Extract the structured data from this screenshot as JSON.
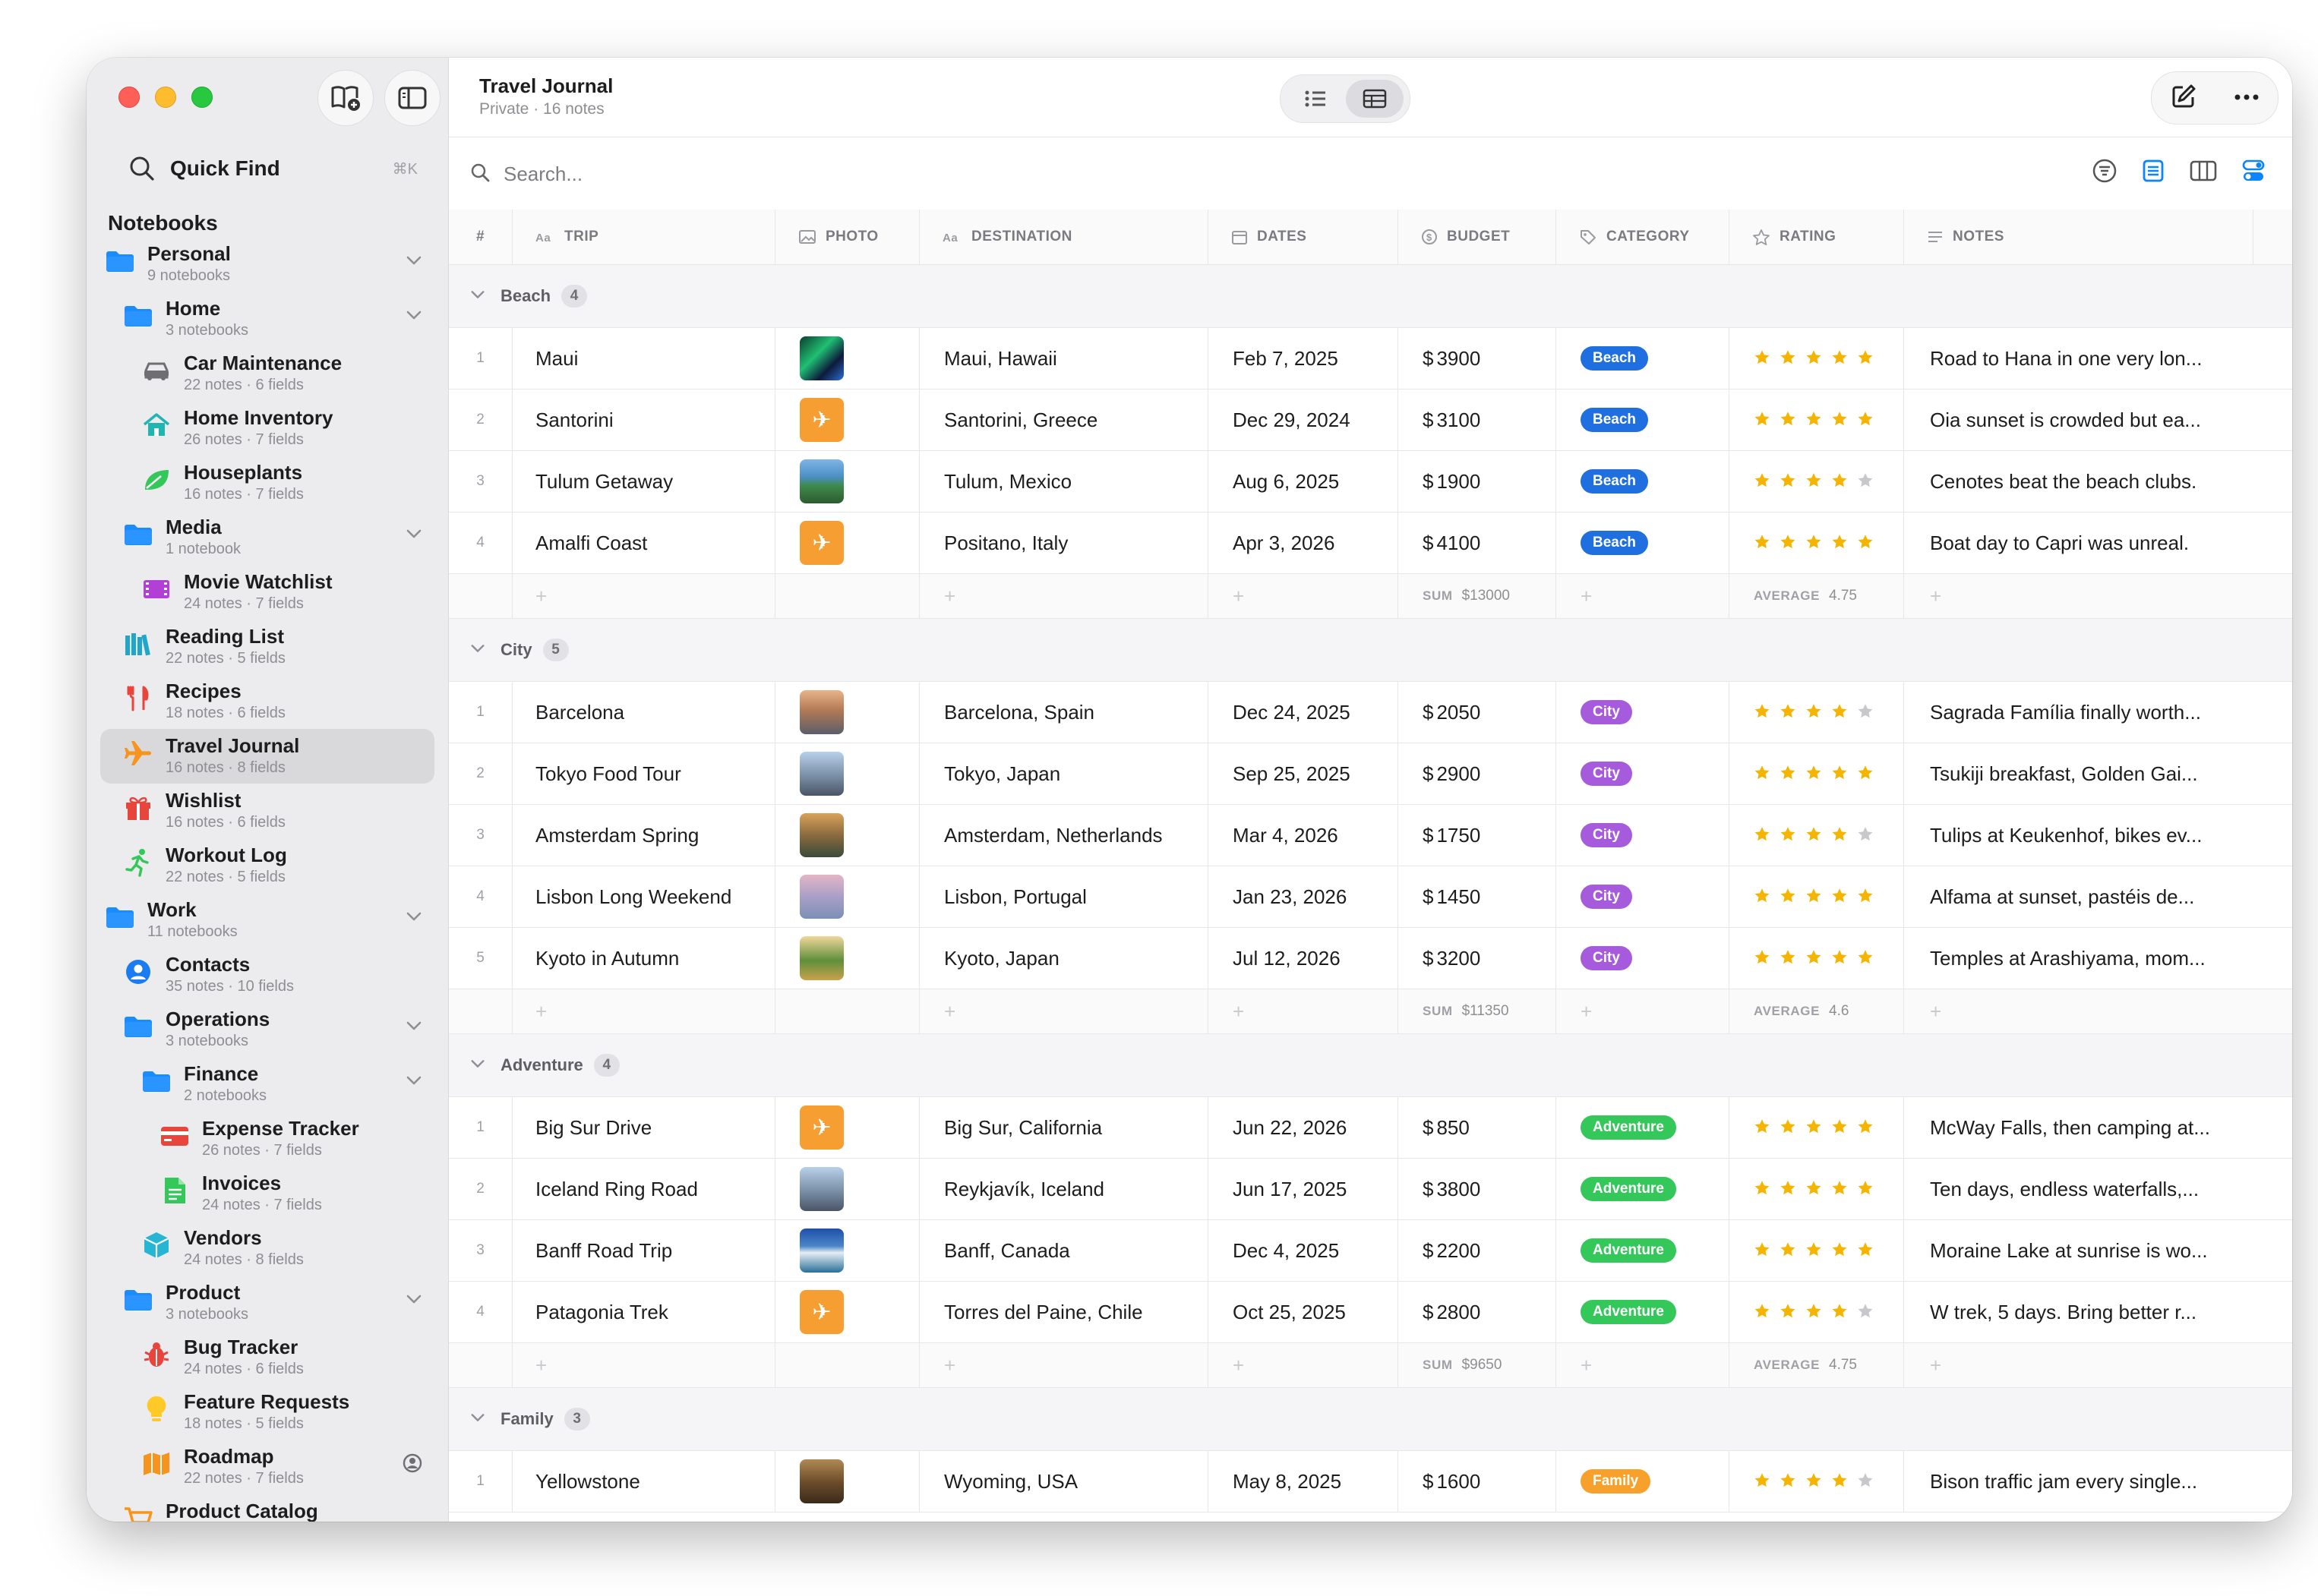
{
  "app": {
    "title": "Travel Journal",
    "subtitle": "Private · 16 notes"
  },
  "sidebar": {
    "quick_find": "Quick Find",
    "quick_find_shortcut": "⌘K",
    "notebooks_heading": "Notebooks",
    "items": [
      {
        "name": "Personal",
        "sub": "9 notebooks",
        "level": 0,
        "icon": "folder-icon",
        "chevron": true
      },
      {
        "name": "Home",
        "sub": "3 notebooks",
        "level": 1,
        "icon": "folder-icon",
        "chevron": true
      },
      {
        "name": "Car Maintenance",
        "sub": "22 notes · 6 fields",
        "level": 2,
        "icon": "car-icon"
      },
      {
        "name": "Home Inventory",
        "sub": "26 notes · 7 fields",
        "level": 2,
        "icon": "house-icon"
      },
      {
        "name": "Houseplants",
        "sub": "16 notes · 7 fields",
        "level": 2,
        "icon": "leaf-icon"
      },
      {
        "name": "Media",
        "sub": "1 notebook",
        "level": 1,
        "icon": "folder-icon",
        "chevron": true
      },
      {
        "name": "Movie Watchlist",
        "sub": "24 notes · 7 fields",
        "level": 2,
        "icon": "film-icon"
      },
      {
        "name": "Reading List",
        "sub": "22 notes · 5 fields",
        "level": 1,
        "icon": "books-icon"
      },
      {
        "name": "Recipes",
        "sub": "18 notes · 6 fields",
        "level": 1,
        "icon": "fork-knife-icon"
      },
      {
        "name": "Travel Journal",
        "sub": "16 notes · 8 fields",
        "level": 1,
        "icon": "airplane-icon",
        "selected": true
      },
      {
        "name": "Wishlist",
        "sub": "16 notes · 6 fields",
        "level": 1,
        "icon": "gift-icon"
      },
      {
        "name": "Workout Log",
        "sub": "22 notes · 5 fields",
        "level": 1,
        "icon": "running-icon"
      },
      {
        "name": "Work",
        "sub": "11 notebooks",
        "level": 0,
        "icon": "folder-icon",
        "chevron": true
      },
      {
        "name": "Contacts",
        "sub": "35 notes · 10 fields",
        "level": 1,
        "icon": "person-icon"
      },
      {
        "name": "Operations",
        "sub": "3 notebooks",
        "level": 1,
        "icon": "folder-icon",
        "chevron": true
      },
      {
        "name": "Finance",
        "sub": "2 notebooks",
        "level": 2,
        "icon": "folder-icon",
        "chevron": true
      },
      {
        "name": "Expense Tracker",
        "sub": "26 notes · 7 fields",
        "level": 3,
        "icon": "credit-card-icon"
      },
      {
        "name": "Invoices",
        "sub": "24 notes · 7 fields",
        "level": 3,
        "icon": "document-icon"
      },
      {
        "name": "Vendors",
        "sub": "24 notes · 8 fields",
        "level": 2,
        "icon": "box-icon"
      },
      {
        "name": "Product",
        "sub": "3 notebooks",
        "level": 1,
        "icon": "folder-icon",
        "chevron": true
      },
      {
        "name": "Bug Tracker",
        "sub": "24 notes · 6 fields",
        "level": 2,
        "icon": "bug-icon"
      },
      {
        "name": "Feature Requests",
        "sub": "18 notes · 5 fields",
        "level": 2,
        "icon": "lightbulb-icon"
      },
      {
        "name": "Roadmap",
        "sub": "22 notes · 7 fields",
        "level": 2,
        "icon": "map-icon",
        "shared": true
      },
      {
        "name": "Product Catalog",
        "sub": "",
        "level": 1,
        "icon": "cart-icon"
      }
    ]
  },
  "search": {
    "placeholder": "Search..."
  },
  "table": {
    "columns": [
      {
        "key": "num",
        "label": "#"
      },
      {
        "key": "trip",
        "label": "TRIP",
        "icon": "text-icon"
      },
      {
        "key": "photo",
        "label": "PHOTO",
        "icon": "image-icon"
      },
      {
        "key": "destination",
        "label": "DESTINATION",
        "icon": "text-icon"
      },
      {
        "key": "dates",
        "label": "DATES",
        "icon": "calendar-icon"
      },
      {
        "key": "budget",
        "label": "BUDGET",
        "icon": "dollar-icon"
      },
      {
        "key": "category",
        "label": "CATEGORY",
        "icon": "tag-icon"
      },
      {
        "key": "rating",
        "label": "RATING",
        "icon": "star-icon"
      },
      {
        "key": "notes",
        "label": "NOTES",
        "icon": "lines-icon"
      }
    ],
    "groups": [
      {
        "name": "Beach",
        "count": "4",
        "color": "#1f6fe0",
        "rows": [
          {
            "n": "1",
            "trip": "Maui",
            "photo": "aurora",
            "destination": "Maui, Hawaii",
            "dates": "Feb 7, 2025",
            "budget": "3900",
            "rating": 5,
            "notes": "Road to Hana in one very lon..."
          },
          {
            "n": "2",
            "trip": "Santorini",
            "photo": "plane",
            "destination": "Santorini, Greece",
            "dates": "Dec 29, 2024",
            "budget": "3100",
            "rating": 5,
            "notes": "Oia sunset is crowded but ea..."
          },
          {
            "n": "3",
            "trip": "Tulum Getaway",
            "photo": "coast",
            "destination": "Tulum, Mexico",
            "dates": "Aug 6, 2025",
            "budget": "1900",
            "rating": 4,
            "notes": "Cenotes beat the beach clubs."
          },
          {
            "n": "4",
            "trip": "Amalfi Coast",
            "photo": "plane",
            "destination": "Positano, Italy",
            "dates": "Apr 3, 2026",
            "budget": "4100",
            "rating": 5,
            "notes": "Boat day to Capri was unreal."
          }
        ],
        "sum_label": "SUM",
        "sum": "$13000",
        "avg_label": "AVERAGE",
        "avg": "4.75"
      },
      {
        "name": "City",
        "count": "5",
        "color": "#a55bdc",
        "rows": [
          {
            "n": "1",
            "trip": "Barcelona",
            "photo": "city1",
            "destination": "Barcelona, Spain",
            "dates": "Dec 24, 2025",
            "budget": "2050",
            "rating": 4,
            "notes": "Sagrada Família finally worth..."
          },
          {
            "n": "2",
            "trip": "Tokyo Food Tour",
            "photo": "city2",
            "destination": "Tokyo, Japan",
            "dates": "Sep 25, 2025",
            "budget": "2900",
            "rating": 5,
            "notes": "Tsukiji breakfast, Golden Gai..."
          },
          {
            "n": "3",
            "trip": "Amsterdam Spring",
            "photo": "city3",
            "destination": "Amsterdam, Netherlands",
            "dates": "Mar 4, 2026",
            "budget": "1750",
            "rating": 4,
            "notes": "Tulips at Keukenhof, bikes ev..."
          },
          {
            "n": "4",
            "trip": "Lisbon Long Weekend",
            "photo": "city4",
            "destination": "Lisbon, Portugal",
            "dates": "Jan 23, 2026",
            "budget": "1450",
            "rating": 5,
            "notes": "Alfama at sunset, pastéis de..."
          },
          {
            "n": "5",
            "trip": "Kyoto in Autumn",
            "photo": "city5",
            "destination": "Kyoto, Japan",
            "dates": "Jul 12, 2026",
            "budget": "3200",
            "rating": 5,
            "notes": "Temples at Arashiyama, mom..."
          }
        ],
        "sum_label": "SUM",
        "sum": "$11350",
        "avg_label": "AVERAGE",
        "avg": "4.6"
      },
      {
        "name": "Adventure",
        "count": "4",
        "color": "#34c759",
        "rows": [
          {
            "n": "1",
            "trip": "Big Sur Drive",
            "photo": "plane",
            "destination": "Big Sur, California",
            "dates": "Jun 22, 2026",
            "budget": "850",
            "rating": 5,
            "notes": "McWay Falls, then camping at..."
          },
          {
            "n": "2",
            "trip": "Iceland Ring Road",
            "photo": "city2",
            "destination": "Reykjavík, Iceland",
            "dates": "Jun 17, 2025",
            "budget": "3800",
            "rating": 5,
            "notes": "Ten days, endless waterfalls,..."
          },
          {
            "n": "3",
            "trip": "Banff Road Trip",
            "photo": "lake",
            "destination": "Banff, Canada",
            "dates": "Dec 4, 2025",
            "budget": "2200",
            "rating": 5,
            "notes": "Moraine Lake at sunrise is wo..."
          },
          {
            "n": "4",
            "trip": "Patagonia Trek",
            "photo": "plane",
            "destination": "Torres del Paine, Chile",
            "dates": "Oct 25, 2025",
            "budget": "2800",
            "rating": 4,
            "notes": "W trek, 5 days. Bring better r..."
          }
        ],
        "sum_label": "SUM",
        "sum": "$9650",
        "avg_label": "AVERAGE",
        "avg": "4.75"
      },
      {
        "name": "Family",
        "count": "3",
        "color": "#f7a12c",
        "rows": [
          {
            "n": "1",
            "trip": "Yellowstone",
            "photo": "canyon",
            "destination": "Wyoming, USA",
            "dates": "May 8, 2025",
            "budget": "1600",
            "rating": 4,
            "notes": "Bison traffic jam every single..."
          }
        ]
      }
    ],
    "currency_symbol": "$",
    "colors": {
      "star": "#f5b400",
      "star_empty": "#c7c7cc",
      "accent": "#0a84ff"
    }
  }
}
